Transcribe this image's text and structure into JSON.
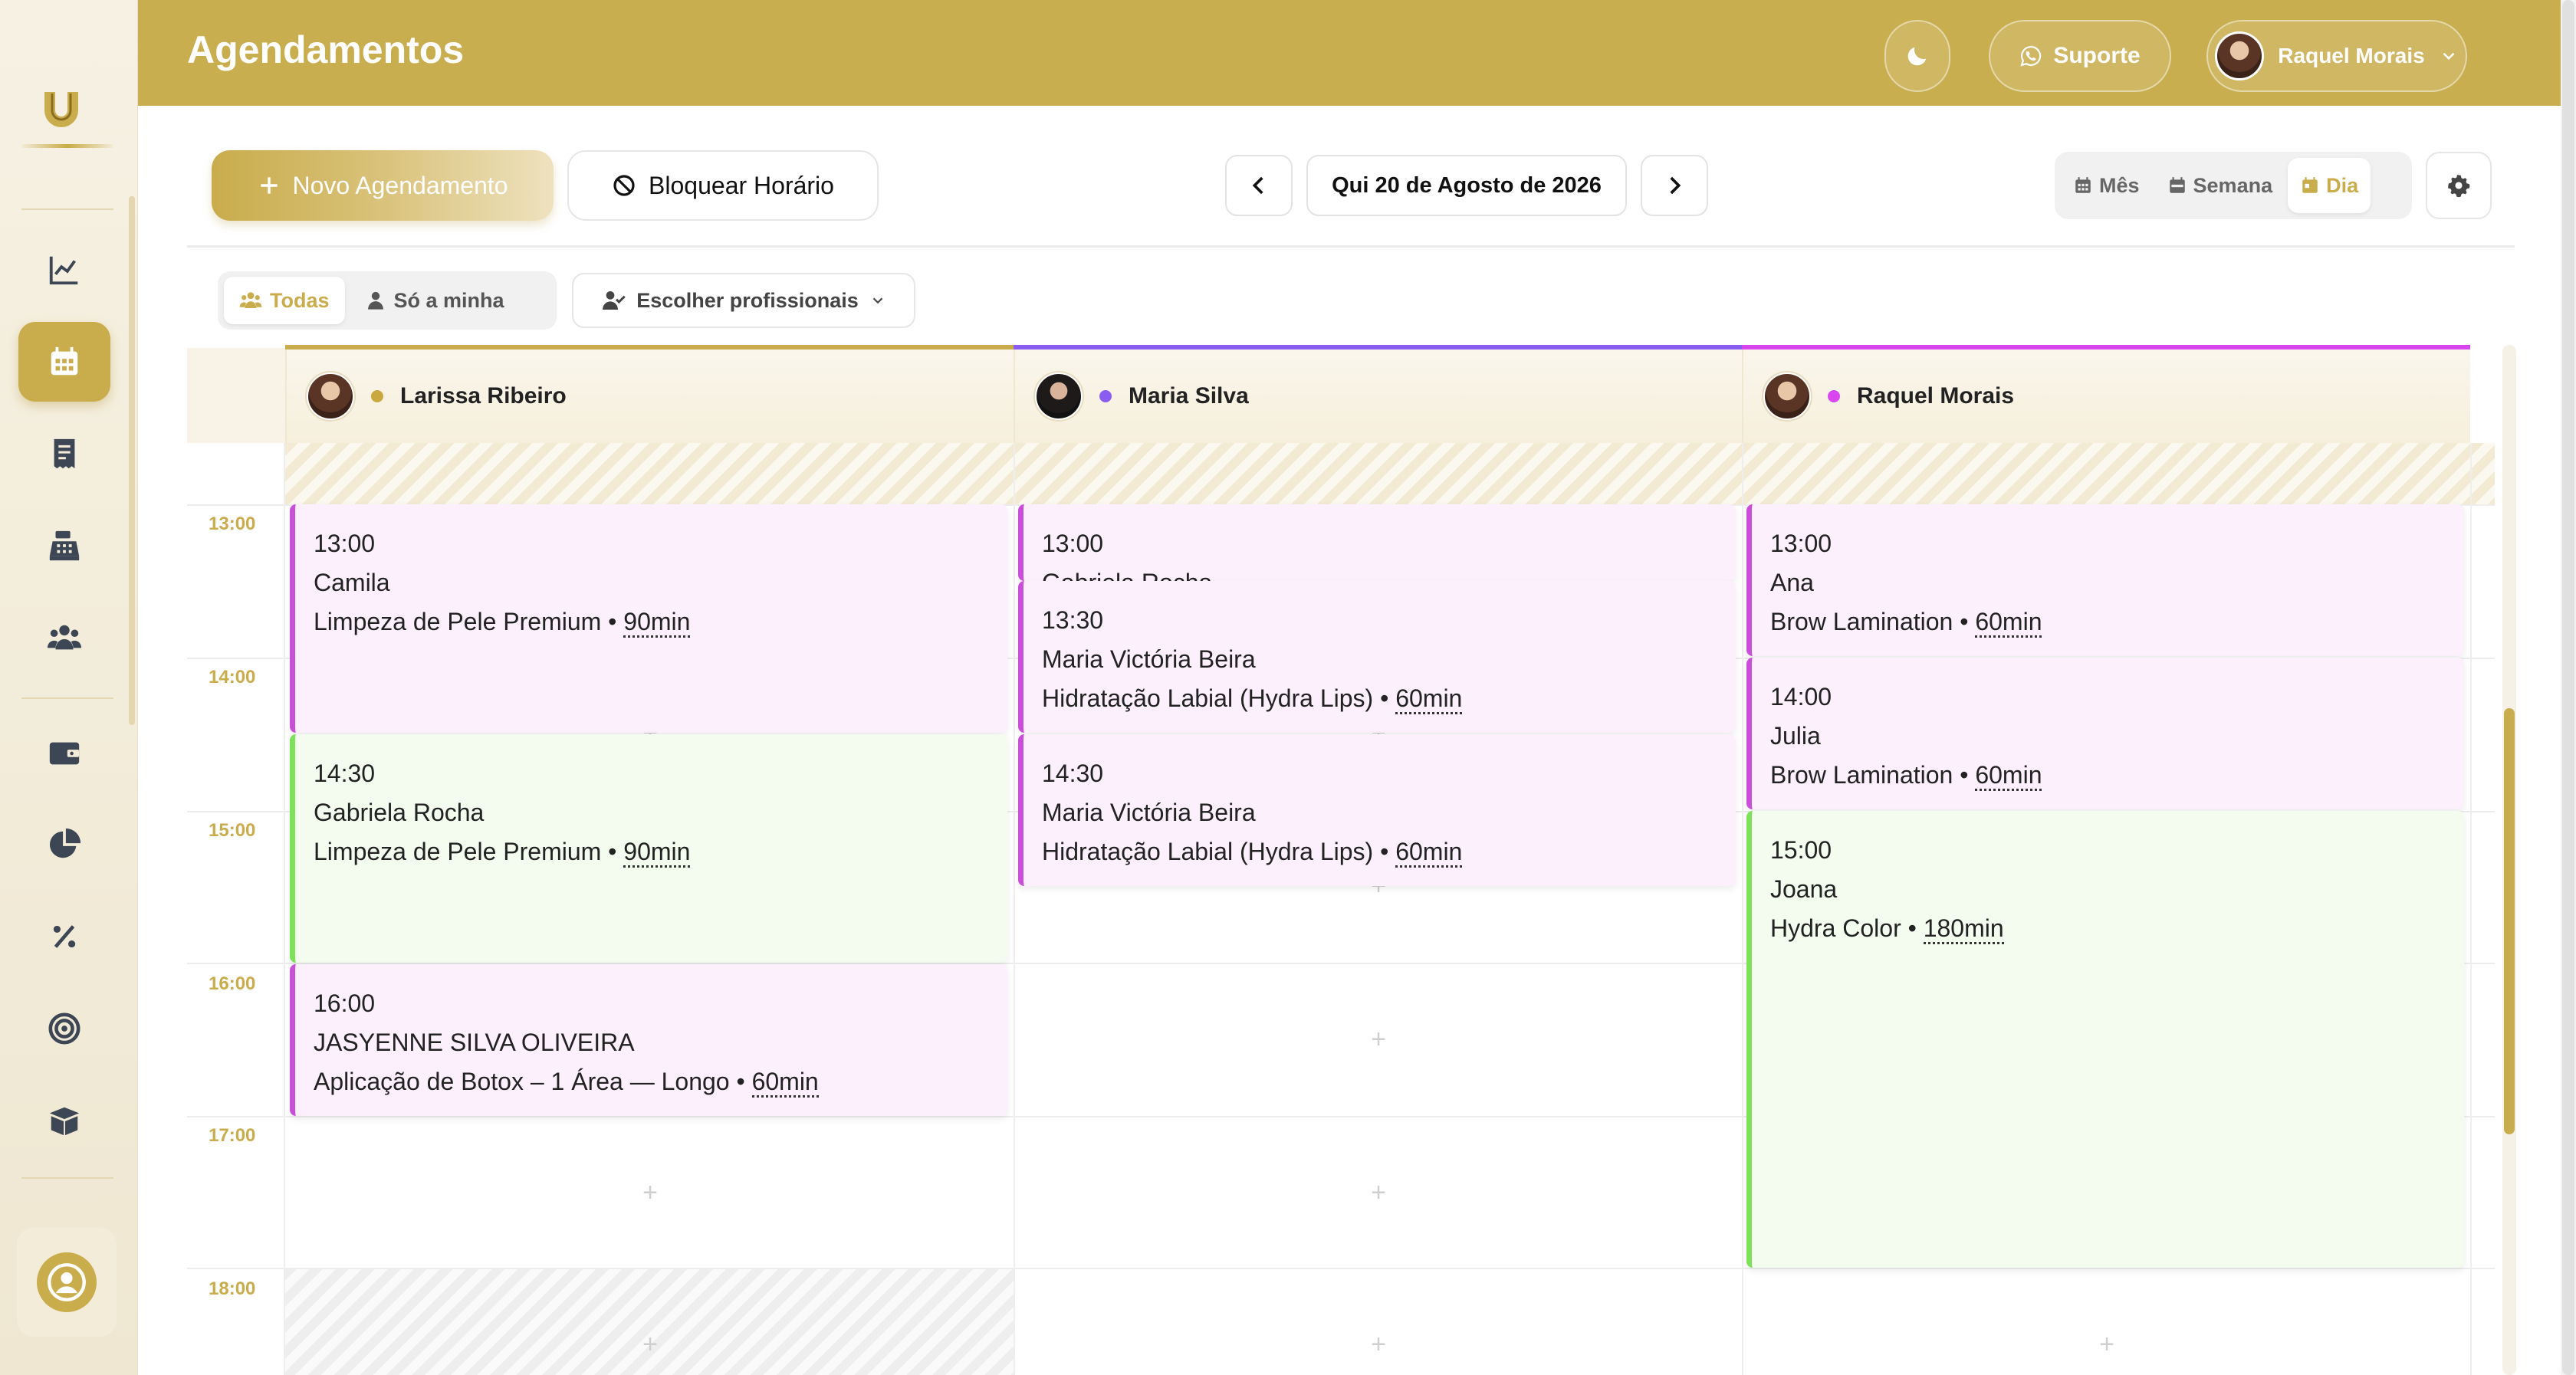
{
  "header": {
    "title": "Agendamentos",
    "support_label": "Suporte",
    "user_name": "Raquel Morais"
  },
  "toolbar": {
    "new_label": "Novo Agendamento",
    "block_label": "Bloquear Horário",
    "date_label": "Qui 20 de Agosto de 2026",
    "views": [
      "Mês",
      "Semana",
      "Dia"
    ],
    "active_view": "Dia"
  },
  "filters": {
    "all_label": "Todas",
    "mine_label": "Só a minha",
    "choose_label": "Escolher profissionais"
  },
  "calendar": {
    "time_labels": [
      "13:00",
      "14:00",
      "15:00",
      "16:00",
      "17:00",
      "18:00"
    ],
    "professionals": [
      {
        "name": "Larissa Ribeiro",
        "color": "#c9a93f"
      },
      {
        "name": "Maria Silva",
        "color": "#8a5cf0"
      },
      {
        "name": "Raquel Morais",
        "color": "#d946ef"
      }
    ],
    "appointments": [
      {
        "column": 0,
        "start": "13:00",
        "client": "Camila",
        "service": "Limpeza de Pele Premium",
        "duration": "90min",
        "style": "pink"
      },
      {
        "column": 0,
        "start": "14:30",
        "client": "Gabriela Rocha",
        "service": "Limpeza de Pele Premium",
        "duration": "90min",
        "style": "green"
      },
      {
        "column": 0,
        "start": "16:00",
        "client": "JASYENNE SILVA OLIVEIRA",
        "service": "Aplicação de Botox – 1 Área — Longo",
        "duration": "60min",
        "style": "pink"
      },
      {
        "column": 1,
        "start": "13:00",
        "client": "Gabriela Rocha",
        "service": "",
        "duration": "",
        "style": "pink"
      },
      {
        "column": 1,
        "start": "13:30",
        "client": "Maria Victória Beira",
        "service": "Hidratação Labial (Hydra Lips)",
        "duration": "60min",
        "style": "pink"
      },
      {
        "column": 1,
        "start": "14:30",
        "client": "Maria Victória Beira",
        "service": "Hidratação Labial (Hydra Lips)",
        "duration": "60min",
        "style": "pink"
      },
      {
        "column": 2,
        "start": "13:00",
        "client": "Ana",
        "service": "Brow Lamination",
        "duration": "60min",
        "style": "pink"
      },
      {
        "column": 2,
        "start": "14:00",
        "client": "Julia",
        "service": "Brow Lamination",
        "duration": "60min",
        "style": "pink"
      },
      {
        "column": 2,
        "start": "15:00",
        "client": "Joana",
        "service": "Hydra Color",
        "duration": "180min",
        "style": "green"
      }
    ]
  }
}
